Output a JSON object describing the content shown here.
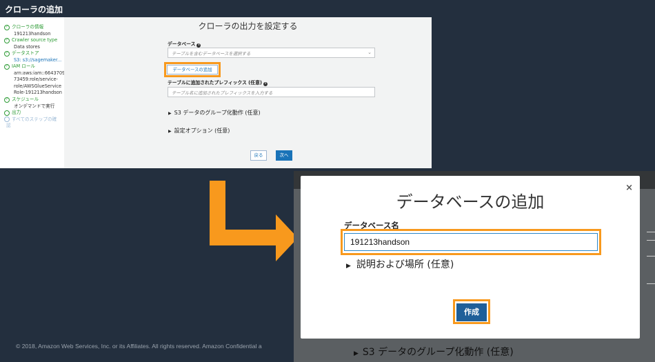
{
  "console": {
    "header_title": "クローラの追加",
    "main_title": "クローラの出力を設定する",
    "steps": [
      {
        "label": "クローラの情報",
        "sub": "191213handson"
      },
      {
        "label": "Crawler source type",
        "sub": "Data stores"
      },
      {
        "label": "データストア",
        "sub": "S3: s3://sagemaker..."
      },
      {
        "label": "IAM ロール",
        "sub1": "arn:aws:iam::6643709",
        "sub2": "73459:role/service-",
        "sub3": "role/AWSGlueService",
        "sub4": "Role-191213handson"
      },
      {
        "label": "スケジュール",
        "sub": "オンデマンドで実行"
      },
      {
        "label": "出力"
      },
      {
        "label": "すべてのステップの確",
        "label2": "認"
      }
    ],
    "database_label": "データベース",
    "database_placeholder": "テーブルを含むデータベースを選択する",
    "add_database_button": "データベースの追加",
    "prefix_label": "テーブルに追加されたプレフィックス (任意)",
    "prefix_placeholder": "テーブル名に追加されたプレフィックスを入力する",
    "expander_grouping": "S3 データのグループ化動作 (任意)",
    "expander_config": "設定オプション (任意)",
    "back_button": "戻る",
    "next_button": "次へ"
  },
  "footer": {
    "copyright": "© 2018, Amazon Web Services, Inc. or its Affiliates. All rights reserved. Amazon Confidential a"
  },
  "modal": {
    "title": "データベースの追加",
    "close_symbol": "×",
    "db_name_label": "データベース名",
    "db_name_value": "191213handson",
    "description_expander": "説明および場所 (任意)",
    "create_button": "作成",
    "backdrop_text": "S3 データのグループ化動作 (任意)"
  },
  "colors": {
    "highlight": "#f8991d",
    "brand_dark": "#232f3e",
    "success_green": "#2b9a33",
    "link_blue": "#1a73b8",
    "primary_button": "#1f5f99"
  },
  "icons": [
    "check-circle-icon",
    "info-icon",
    "chevron-down-icon",
    "caret-right-icon",
    "close-icon",
    "arrow-icon"
  ]
}
